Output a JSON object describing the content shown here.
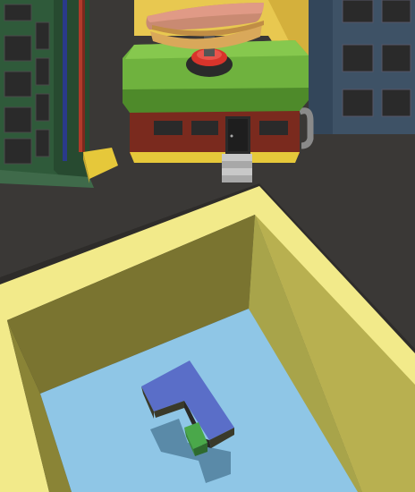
{
  "scene": {
    "type": "3d-game-viewport",
    "colors": {
      "ground": "#3a3836",
      "building_left": "#2f5a3a",
      "building_right": "#3e5266",
      "shop_roof": "#6fb23e",
      "shop_wall": "#7a2a1e",
      "hotdog_bun": "#d9a85a",
      "hotdog_sausage": "#c98a72",
      "button_red": "#d8342b",
      "pole_yellow": "#e6c83a",
      "box_rim": "#f2ea8a",
      "box_wall_dark": "#6c6a2a",
      "box_wall_light": "#a8a44a",
      "box_floor": "#8fc6e6",
      "block_blue": "#5a6ec8",
      "block_green": "#4aa84a"
    },
    "icons": [
      "hotdog-sign-icon",
      "red-button-icon",
      "shop-door-icon"
    ]
  }
}
